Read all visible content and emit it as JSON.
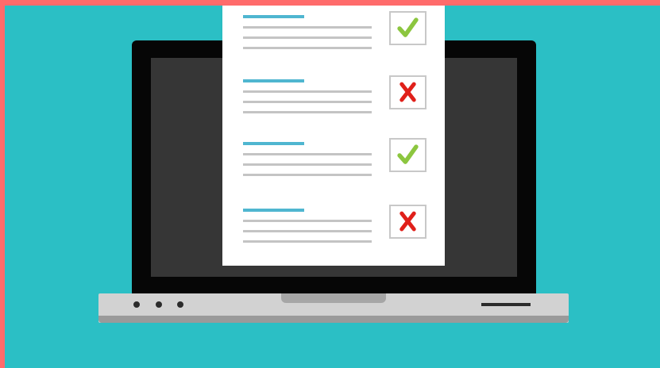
{
  "colors": {
    "border": "#ff6b6b",
    "background": "#2bbfc5",
    "bezel": "#060606",
    "screen": "#363636",
    "document": "#ffffff",
    "heading_bar": "#4fb6d0",
    "text_bar": "#c4c4c4",
    "check": "#8cc63f",
    "cross": "#e0201a"
  },
  "checklist": {
    "items": [
      {
        "status": "check",
        "icon": "checkmark-icon"
      },
      {
        "status": "cross",
        "icon": "cross-icon"
      },
      {
        "status": "check",
        "icon": "checkmark-icon"
      },
      {
        "status": "cross",
        "icon": "cross-icon"
      }
    ]
  },
  "laptop": {
    "indicator_lights": 3,
    "icon": "laptop-icon"
  }
}
